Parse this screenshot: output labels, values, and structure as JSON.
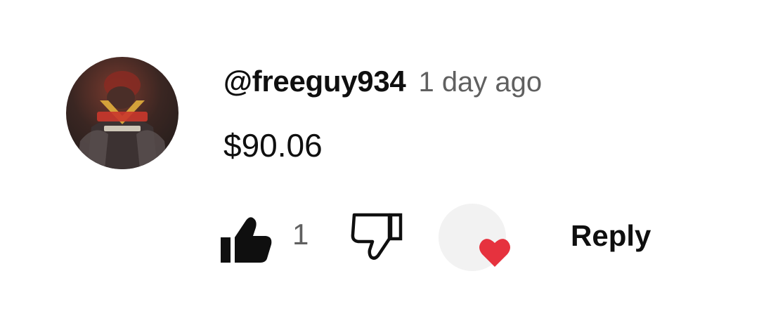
{
  "comment": {
    "author": "@freeguy934",
    "time": "1 day ago",
    "text": "$90.06"
  },
  "actions": {
    "like_count": "1",
    "reply_label": "Reply"
  },
  "icons": {
    "like": "thumbs-up-filled-icon",
    "dislike": "thumbs-down-outline-icon",
    "heart": "creator-heart-icon",
    "avatar": "user-avatar"
  },
  "colors": {
    "author": "#0f0f0f",
    "time": "#606060",
    "heart": "#e6323e",
    "heart_bg": "#f2f2f2"
  }
}
